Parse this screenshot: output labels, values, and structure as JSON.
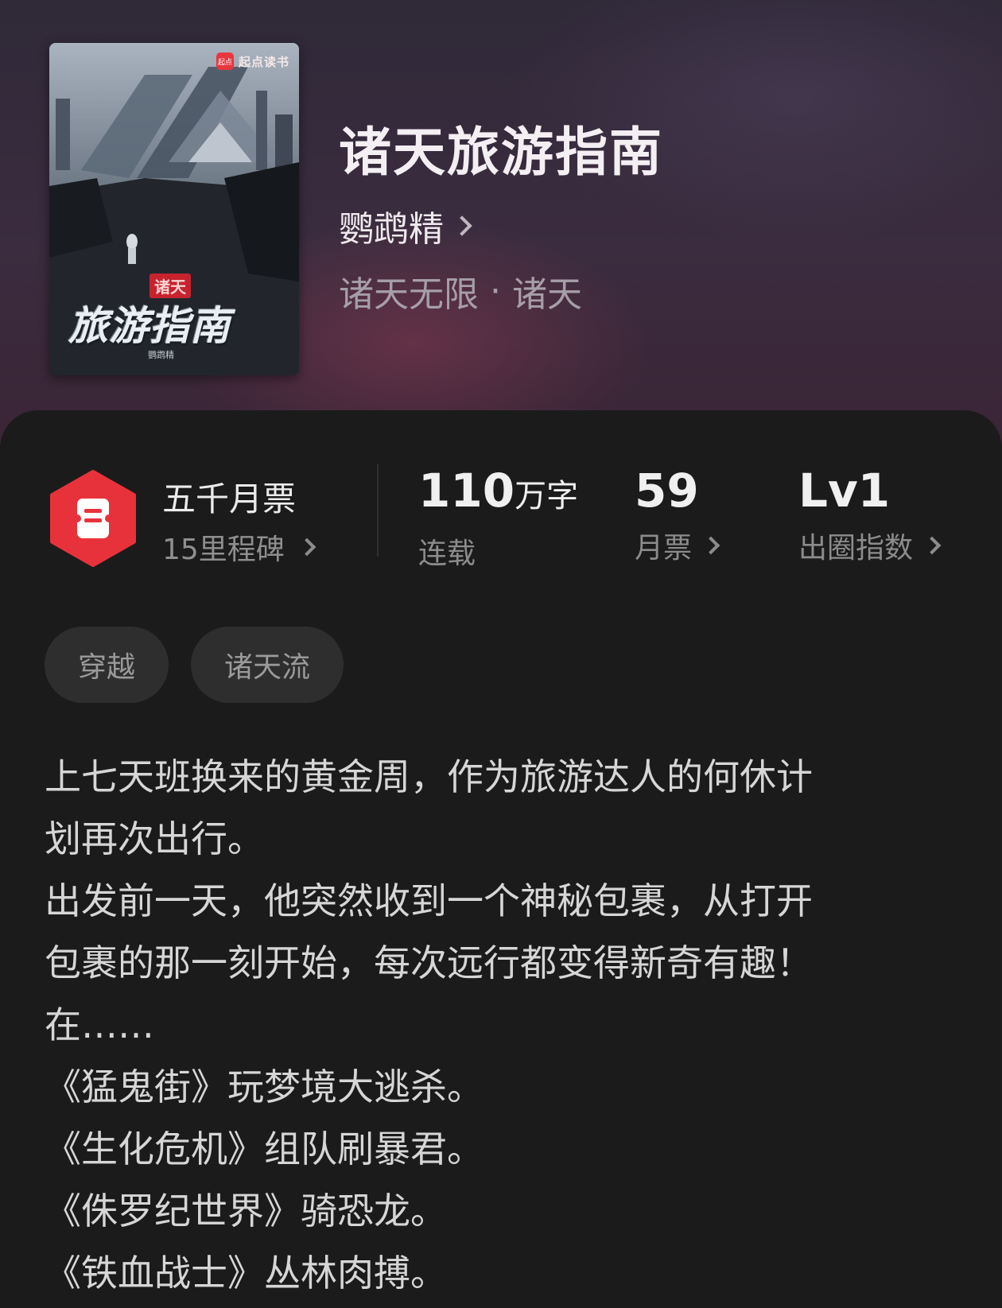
{
  "book": {
    "title": "诸天旅游指南",
    "author": "鹦鹉精",
    "category": "诸天无限",
    "separator": "·",
    "subcategory": "诸天"
  },
  "cover": {
    "brand": "起点读书",
    "brand_logo": "起点",
    "subtitle": "诸天",
    "title": "旅游指南",
    "author": "鹦鹉精"
  },
  "badge": {
    "title": "五千月票",
    "subtitle": "15里程碑",
    "icon": "ticket-hexagon-icon",
    "color": "#e8323b"
  },
  "stats": {
    "word_count_value": "110",
    "word_count_unit": "万字",
    "word_count_label": "连载",
    "monthly_tickets_value": "59",
    "monthly_tickets_label": "月票",
    "influence_value": "Lv1",
    "influence_label": "出圈指数"
  },
  "tags": [
    "穿越",
    "诸天流"
  ],
  "description": [
    "上七天班换来的黄金周，作为旅游达人的何休计",
    "划再次出行。",
    "出发前一天，他突然收到一个神秘包裹，从打开",
    "包裹的那一刻开始，每次远行都变得新奇有趣！",
    "在……",
    "《猛鬼街》玩梦境大逃杀。",
    "《生化危机》组队刷暴君。",
    "《侏罗纪世界》骑恐龙。",
    "《铁血战士》丛林肉搏。"
  ]
}
